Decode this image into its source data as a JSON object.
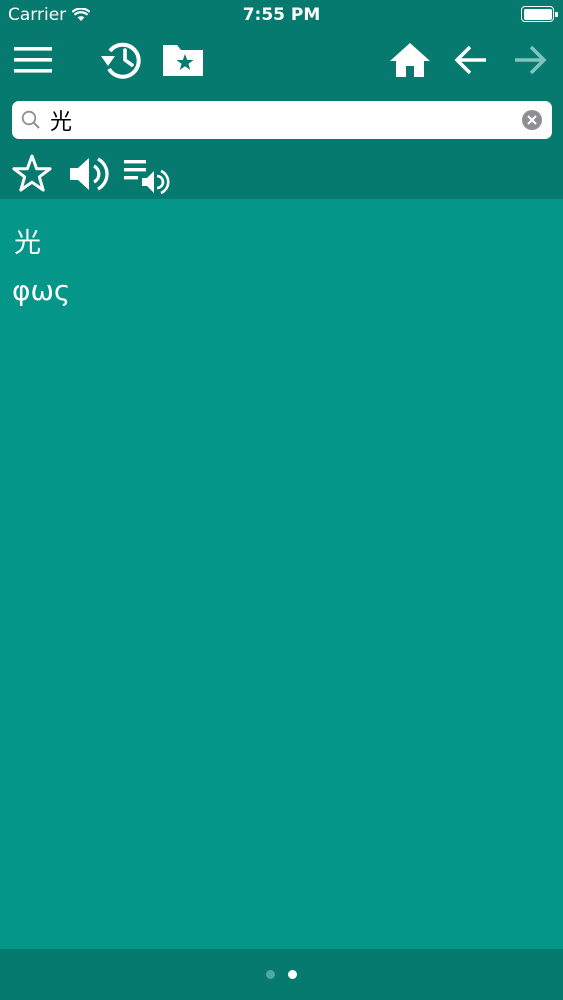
{
  "status_bar": {
    "carrier": "Carrier",
    "time": "7:55 PM"
  },
  "toolbar": {
    "icons": [
      "menu-icon",
      "history-icon",
      "favorites-folder-icon",
      "home-icon",
      "back-arrow-icon",
      "forward-arrow-icon"
    ]
  },
  "search": {
    "value": "光"
  },
  "actions": {
    "icons": [
      "star-icon",
      "speaker-icon",
      "playlist-speaker-icon"
    ]
  },
  "entry": {
    "word": "光",
    "translation": "φως"
  },
  "page_indicator": {
    "pages": 2,
    "current": 2
  },
  "colors": {
    "header_bg": "#067a6f",
    "content_bg": "#049688",
    "text": "#ffffff",
    "disabled_icon": "#7fc4bd"
  }
}
